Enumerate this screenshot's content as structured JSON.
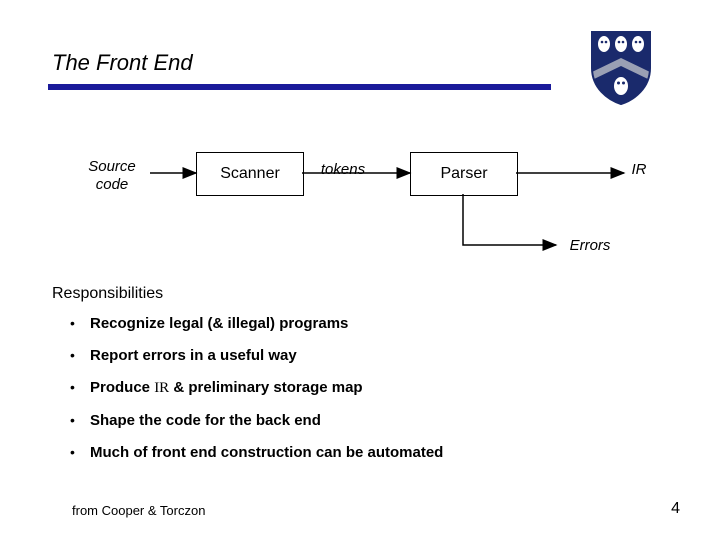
{
  "title": "The Front End",
  "diagram": {
    "source_label": "Source\ncode",
    "scanner_label": "Scanner",
    "tokens_label": "tokens",
    "parser_label": "Parser",
    "ir_label": "IR",
    "errors_label": "Errors"
  },
  "section_heading": "Responsibilities",
  "bullets": [
    "Recognize legal (& illegal) programs",
    "Report errors in a useful way",
    "Produce IR & preliminary storage map",
    "Shape the code for the back end",
    "Much of front end construction can be automated"
  ],
  "footer": {
    "left": "from Cooper & Torczon",
    "page": "4"
  },
  "crest": {
    "name": "rice-owl-shield",
    "colors": {
      "blue": "#1a2a6c",
      "white": "#ffffff",
      "grey": "#9aa0b4"
    }
  }
}
